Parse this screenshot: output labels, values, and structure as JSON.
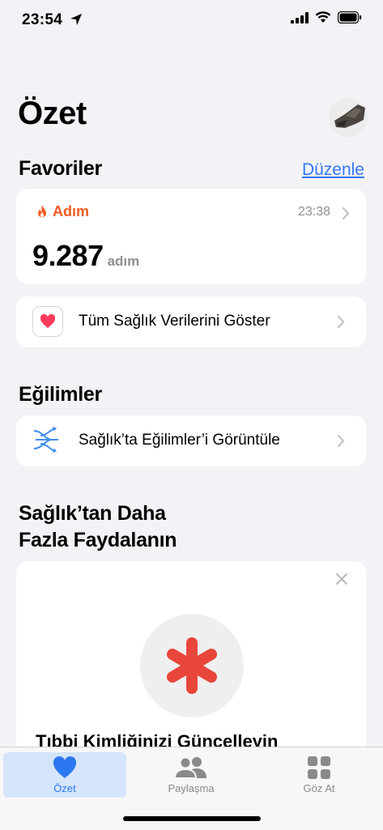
{
  "status": {
    "time": "23:54"
  },
  "header": {
    "title": "Özet"
  },
  "favorites": {
    "title": "Favoriler",
    "edit_label": "Düzenle",
    "steps_card": {
      "label": "Adım",
      "time": "23:38",
      "value": "9.287",
      "unit": "adım"
    },
    "all_data_label": "Tüm Sağlık Verilerini Göster"
  },
  "trends": {
    "title": "Eğilimler",
    "row_label": "Sağlık’ta Eğilimler’i Görüntüle"
  },
  "more": {
    "title_line1": "Sağlık’tan Daha",
    "title_line2": "Fazla Faydalanın",
    "card_text": "Tıbbi Kimliğinizi Güncelleyin"
  },
  "tabs": [
    {
      "label": "Özet",
      "active": true
    },
    {
      "label": "Paylaşma",
      "active": false
    },
    {
      "label": "Göz At",
      "active": false
    }
  ],
  "colors": {
    "accent": "#3478f6",
    "steps": "#f05b22",
    "heart": "#ff3b5c",
    "medical": "#e8463b"
  }
}
